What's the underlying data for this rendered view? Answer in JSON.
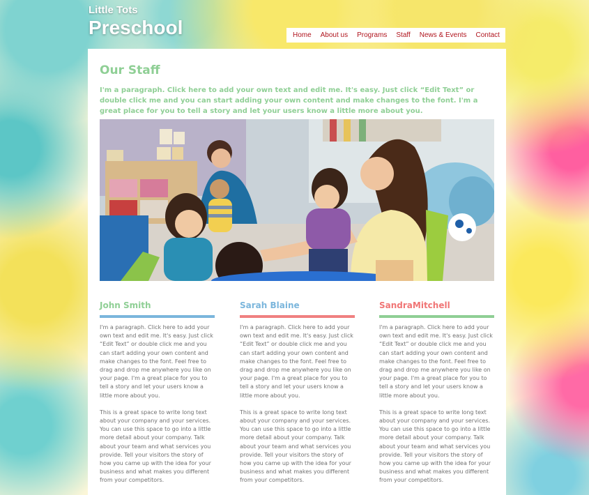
{
  "site": {
    "brand_top": "Little Tots",
    "brand_main": "Preschool"
  },
  "nav": {
    "items": [
      "Home",
      "About us",
      "Programs",
      "Staff",
      "News & Events",
      "Contact"
    ]
  },
  "page": {
    "title": "Our Staff",
    "intro": "I'm a paragraph. Click here to add your own text and edit me. It's easy. Just click “Edit Text” or double click me and you can start adding your own content and make changes to the font. I'm a great place for you to tell a story and let your users know a little more about you."
  },
  "staff": [
    {
      "name": "John Smith",
      "color": "#7bb6dc",
      "name_color": "#8fcf95",
      "p1": "I'm a paragraph. Click here to add your own text and edit me. It's easy. Just click “Edit Text” or double click me and you can start adding your own content and make changes to the font. Feel free to drag and drop me anywhere you like on your page. I'm a great place for you to tell a story and let your users know a little more about you.",
      "p2": "This is a great space to write long text about your company and your services. You can use this space to go into a little more detail about your company. Talk about your team and what services you provide. Tell your visitors the story of how you came up with the idea for your business and what makes you different from your competitors."
    },
    {
      "name": "Sarah Blaine",
      "color": "#f08080",
      "name_color": "#7bb6dc",
      "p1": "I'm a paragraph. Click here to add your own text and edit me. It's easy. Just click “Edit Text” or double click me and you can start adding your own content and make changes to the font. Feel free to drag and drop me anywhere you like on your page. I'm a great place for you to tell a story and let your users know a little more about you.",
      "p2": "This is a great space to write long text about your company and your services. You can use this space to go into a little more detail about your company. Talk about your team and what services you provide. Tell your visitors the story of how you came up with the idea for your business and what makes you different from your competitors."
    },
    {
      "name": "SandraMitchell",
      "color": "#8fcf95",
      "name_color": "#f07575",
      "p1": "I'm a paragraph. Click here to add your own text and edit me. It's easy. Just click “Edit Text” or double click me and you can start adding your own content and make changes to the font. Feel free to drag and drop me anywhere you like on your page. I'm a great place for you to tell a story and let your users know a little more about you.",
      "p2": "This is a great space to write long text about your company and your services. You can use this space to go into a little more detail about your company. Talk about your team and what services you provide. Tell your visitors the story of how you came up with the idea for your business and what makes you different from your competitors."
    }
  ],
  "colors": {
    "nav_text": "#b0151e",
    "accent_green": "#8fcf95",
    "accent_blue": "#7bb6dc",
    "accent_red": "#f08080"
  }
}
